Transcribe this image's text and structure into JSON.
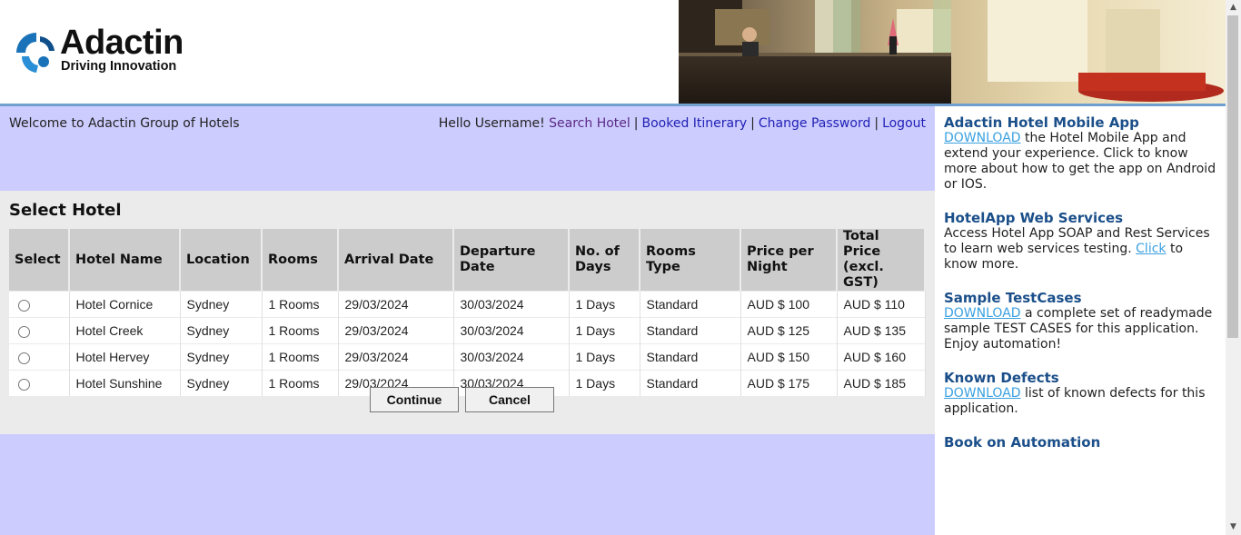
{
  "header": {
    "brand_name": "Adactin",
    "brand_tagline": "Driving Innovation"
  },
  "topbar": {
    "welcome": "Welcome to Adactin Group of Hotels",
    "greeting": "Hello Username!",
    "links": {
      "search_hotel": "Search Hotel",
      "booked_itinerary": "Booked Itinerary",
      "change_password": "Change Password",
      "logout": "Logout"
    },
    "separator": "|"
  },
  "select_hotel": {
    "title": "Select Hotel",
    "columns": {
      "select": "Select",
      "hotel_name": "Hotel Name",
      "location": "Location",
      "rooms": "Rooms",
      "arrival": "Arrival Date",
      "departure_1": "Departure",
      "departure_2": "Date",
      "days_1": "No. of",
      "days_2": "Days",
      "rooms_type": "Rooms Type",
      "price_1": "Price per",
      "price_2": "Night",
      "total_1": "Total Price",
      "total_2": "(excl. GST)"
    },
    "rows": [
      {
        "hotel": "Hotel Cornice",
        "location": "Sydney",
        "rooms": "1 Rooms",
        "arrival": "29/03/2024",
        "departure": "30/03/2024",
        "days": "1 Days",
        "type": "Standard",
        "price": "AUD $ 100",
        "total": "AUD $ 110"
      },
      {
        "hotel": "Hotel Creek",
        "location": "Sydney",
        "rooms": "1 Rooms",
        "arrival": "29/03/2024",
        "departure": "30/03/2024",
        "days": "1 Days",
        "type": "Standard",
        "price": "AUD $ 125",
        "total": "AUD $ 135"
      },
      {
        "hotel": "Hotel Hervey",
        "location": "Sydney",
        "rooms": "1 Rooms",
        "arrival": "29/03/2024",
        "departure": "30/03/2024",
        "days": "1 Days",
        "type": "Standard",
        "price": "AUD $ 150",
        "total": "AUD $ 160"
      },
      {
        "hotel": "Hotel Sunshine",
        "location": "Sydney",
        "rooms": "1 Rooms",
        "arrival": "29/03/2024",
        "departure": "30/03/2024",
        "days": "1 Days",
        "type": "Standard",
        "price": "AUD $ 175",
        "total": "AUD $ 185"
      }
    ],
    "continue_label": "Continue",
    "cancel_label": "Cancel"
  },
  "sidebar": {
    "mobile_app": {
      "title": "Adactin Hotel Mobile App",
      "link": "DOWNLOAD",
      "text": " the Hotel Mobile App and extend your experience. Click to know more about how to get the app on Android or IOS."
    },
    "web_services": {
      "title": "HotelApp Web Services",
      "text_before": "Access Hotel App SOAP and Rest Services to learn web services testing. ",
      "link": "Click",
      "text_after": " to know more."
    },
    "test_cases": {
      "title": "Sample TestCases",
      "link": "DOWNLOAD",
      "text": " a complete set of readymade sample TEST CASES for this application. Enjoy automation!"
    },
    "known_defects": {
      "title": "Known Defects",
      "link": "DOWNLOAD",
      "text": " list of known defects for this application."
    },
    "book": {
      "title": "Book on Automation"
    }
  },
  "colors": {
    "main_bg": "#ccccff",
    "panel_bg": "#ebebeb",
    "table_header_bg": "#cccccc",
    "sidebar_title": "#1b4f8a",
    "sidebar_link": "#3aa0e0",
    "nav_link": "#1f1fb4"
  },
  "icons": [
    "adactin-logo-icon",
    "hotel-lobby-banner"
  ]
}
